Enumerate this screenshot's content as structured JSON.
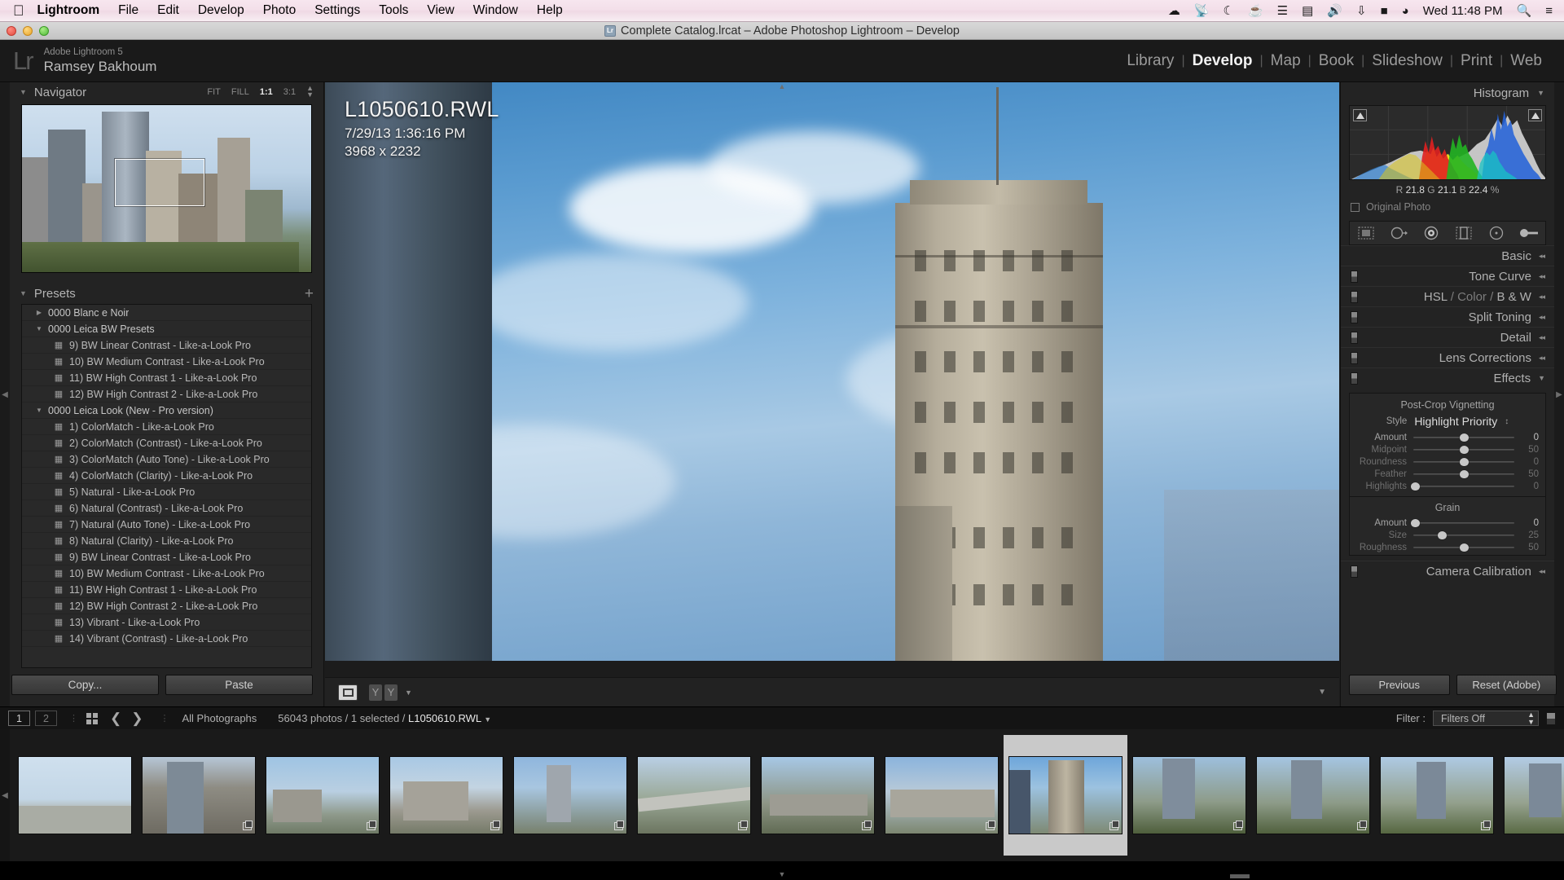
{
  "macmenu": {
    "apple_icon": "apple-icon",
    "items": [
      "Lightroom",
      "File",
      "Edit",
      "Develop",
      "Photo",
      "Settings",
      "Tools",
      "View",
      "Window",
      "Help"
    ],
    "status_icons": [
      "cloud-icon",
      "wifi-signal-icon",
      "moon-icon",
      "cup-icon",
      "equalizer-icon",
      "display-icon",
      "volume-icon",
      "bluetooth-icon",
      "battery-icon",
      "wifi-icon"
    ],
    "clock": "Wed 11:48 PM",
    "search_icon": "search-icon",
    "list_icon": "notification-center-icon"
  },
  "window": {
    "title": "Complete Catalog.lrcat – Adobe Photoshop Lightroom – Develop",
    "app_icon": "lightroom-document-icon",
    "close": "close-button",
    "minimize": "minimize-button",
    "zoom": "zoom-button"
  },
  "identity": {
    "logo": "Lr",
    "product": "Adobe Lightroom 5",
    "user": "Ramsey Bakhoum"
  },
  "modules": {
    "items": [
      {
        "label": "Library",
        "active": false
      },
      {
        "label": "Develop",
        "active": true
      },
      {
        "label": "Map",
        "active": false
      },
      {
        "label": "Book",
        "active": false
      },
      {
        "label": "Slideshow",
        "active": false
      },
      {
        "label": "Print",
        "active": false
      },
      {
        "label": "Web",
        "active": false
      }
    ],
    "separator": "|"
  },
  "navigator": {
    "title": "Navigator",
    "collapse_icon": "triangle-down-icon",
    "zoom_levels": [
      "FIT",
      "FILL",
      "1:1",
      "3:1"
    ],
    "active_zoom": "1:1",
    "stepper_icon": "stepper-icon"
  },
  "presets": {
    "title": "Presets",
    "collapse_icon": "triangle-down-icon",
    "add_icon": "plus-icon",
    "rows": [
      {
        "label": "0000 Blanc e Noir",
        "type": "group",
        "expanded": false
      },
      {
        "label": "0000 Leica BW Presets",
        "type": "group",
        "expanded": true
      },
      {
        "label": "9)  BW Linear Contrast - Like-a-Look Pro",
        "type": "preset"
      },
      {
        "label": "10) BW Medium Contrast - Like-a-Look Pro",
        "type": "preset"
      },
      {
        "label": "11) BW High Contrast 1 - Like-a-Look Pro",
        "type": "preset"
      },
      {
        "label": "12) BW High Contrast 2 - Like-a-Look Pro",
        "type": "preset"
      },
      {
        "label": "0000 Leica Look (New - Pro version)",
        "type": "group",
        "expanded": true
      },
      {
        "label": "1)  ColorMatch - Like-a-Look Pro",
        "type": "preset"
      },
      {
        "label": "2)  ColorMatch (Contrast) - Like-a-Look Pro",
        "type": "preset"
      },
      {
        "label": "3)  ColorMatch (Auto Tone) - Like-a-Look Pro",
        "type": "preset"
      },
      {
        "label": "4)  ColorMatch (Clarity) - Like-a-Look Pro",
        "type": "preset"
      },
      {
        "label": "5)  Natural - Like-a-Look Pro",
        "type": "preset"
      },
      {
        "label": "6)  Natural (Contrast) - Like-a-Look Pro",
        "type": "preset"
      },
      {
        "label": "7)  Natural (Auto Tone) - Like-a-Look Pro",
        "type": "preset"
      },
      {
        "label": "8)  Natural (Clarity) - Like-a-Look Pro",
        "type": "preset"
      },
      {
        "label": "9)  BW Linear Contrast - Like-a-Look Pro",
        "type": "preset"
      },
      {
        "label": "10) BW Medium Contrast - Like-a-Look Pro",
        "type": "preset"
      },
      {
        "label": "11) BW High Contrast 1 - Like-a-Look Pro",
        "type": "preset"
      },
      {
        "label": "12) BW High Contrast 2 - Like-a-Look Pro",
        "type": "preset"
      },
      {
        "label": "13) Vibrant - Like-a-Look Pro",
        "type": "preset"
      },
      {
        "label": "14) Vibrant (Contrast) - Like-a-Look Pro",
        "type": "preset"
      }
    ],
    "copy_label": "Copy...",
    "paste_label": "Paste"
  },
  "photo_info": {
    "filename": "L1050610.RWL",
    "captured": "7/29/13 1:36:16 PM",
    "dimensions": "3968 x 2232"
  },
  "center_toolbar": {
    "view_icon": "loupe-view-icon",
    "flag_icons": [
      "flag-y-icon",
      "flag-y-icon"
    ],
    "dropdown_icon": "caret-down-icon",
    "panel_caret": "caret-down-icon"
  },
  "histogram": {
    "title": "Histogram",
    "collapse_icon": "triangle-down-icon",
    "shadow_clip_icon": "shadow-clipping-icon",
    "highlight_clip_icon": "highlight-clipping-icon",
    "readout": {
      "r_label": "R",
      "r": "21.8",
      "g_label": "G",
      "g": "21.1",
      "b_label": "B",
      "b": "22.4",
      "unit": "%"
    },
    "original_photo_label": "Original Photo",
    "original_photo_checkbox": "original-photo-checkbox"
  },
  "tools": [
    {
      "name": "crop-overlay-tool"
    },
    {
      "name": "spot-removal-tool"
    },
    {
      "name": "red-eye-correction-tool"
    },
    {
      "name": "graduated-filter-tool"
    },
    {
      "name": "radial-filter-tool"
    },
    {
      "name": "adjustment-brush-tool"
    }
  ],
  "panels": [
    {
      "title": "Basic",
      "switch": false,
      "arrows": "disclosure-arrows-icon"
    },
    {
      "title": "Tone Curve",
      "switch": true,
      "arrows": "disclosure-arrows-icon"
    },
    {
      "title": "HSL / Color / B & W",
      "switch": true,
      "arrows": "disclosure-arrows-icon",
      "segments": [
        {
          "t": "HSL",
          "active": true
        },
        {
          "t": "/",
          "active": false
        },
        {
          "t": "Color",
          "active": false
        },
        {
          "t": "/",
          "active": false
        },
        {
          "t": "B & W",
          "active": true
        }
      ]
    },
    {
      "title": "Split Toning",
      "switch": true,
      "arrows": "disclosure-arrows-icon"
    },
    {
      "title": "Detail",
      "switch": true,
      "arrows": "disclosure-arrows-icon"
    },
    {
      "title": "Lens Corrections",
      "switch": true,
      "arrows": "disclosure-arrows-icon"
    },
    {
      "title": "Effects",
      "switch": true,
      "arrows": "disclosure-arrows-icon",
      "expanded": true
    }
  ],
  "effects": {
    "vignetting_title": "Post-Crop Vignetting",
    "style_label": "Style",
    "style_value": "Highlight Priority",
    "style_stepper": "stepper-icon",
    "vignette_sliders": [
      {
        "label": "Amount",
        "value": "0",
        "pos": 50,
        "dim": false
      },
      {
        "label": "Midpoint",
        "value": "50",
        "pos": 50,
        "dim": true
      },
      {
        "label": "Roundness",
        "value": "0",
        "pos": 50,
        "dim": true
      },
      {
        "label": "Feather",
        "value": "50",
        "pos": 50,
        "dim": true
      },
      {
        "label": "Highlights",
        "value": "0",
        "pos": 2,
        "dim": true
      }
    ],
    "grain_title": "Grain",
    "grain_sliders": [
      {
        "label": "Amount",
        "value": "0",
        "pos": 2,
        "dim": false
      },
      {
        "label": "Size",
        "value": "25",
        "pos": 28,
        "dim": true
      },
      {
        "label": "Roughness",
        "value": "50",
        "pos": 50,
        "dim": true
      }
    ]
  },
  "camera_calibration": {
    "title": "Camera Calibration",
    "arrows": "disclosure-arrows-icon"
  },
  "right_buttons": {
    "previous": "Previous",
    "reset": "Reset (Adobe)"
  },
  "filmstrip_header": {
    "page1": "1",
    "page2": "2",
    "grid_icon": "grid-view-icon",
    "back_icon": "arrow-left-icon",
    "forward_icon": "arrow-right-icon",
    "source": "All Photographs",
    "count_prefix": "56043 photos / 1 selected / ",
    "selected_file": "L1050610.RWL",
    "dropdown_icon": "caret-down-icon",
    "filter_label": "Filter :",
    "filter_value": "Filters Off",
    "filter_stepper": "stepper-icon",
    "filter_switch": "filter-enable-switch"
  },
  "filmstrip": {
    "thumbs": [
      {
        "name": "thumb-1",
        "selected": false,
        "badge": false
      },
      {
        "name": "thumb-2",
        "selected": false,
        "badge": true
      },
      {
        "name": "thumb-3",
        "selected": false,
        "badge": true
      },
      {
        "name": "thumb-4",
        "selected": false,
        "badge": true
      },
      {
        "name": "thumb-5",
        "selected": false,
        "badge": true
      },
      {
        "name": "thumb-6",
        "selected": false,
        "badge": true
      },
      {
        "name": "thumb-7",
        "selected": false,
        "badge": true
      },
      {
        "name": "thumb-8",
        "selected": false,
        "badge": true
      },
      {
        "name": "thumb-9",
        "selected": true,
        "badge": true
      },
      {
        "name": "thumb-10",
        "selected": false,
        "badge": true
      },
      {
        "name": "thumb-11",
        "selected": false,
        "badge": true
      },
      {
        "name": "thumb-12",
        "selected": false,
        "badge": true
      },
      {
        "name": "thumb-13",
        "selected": false,
        "badge": false
      }
    ]
  },
  "handles": {
    "left": "◀",
    "right": "▶",
    "top": "▲",
    "bottom": "▼"
  }
}
